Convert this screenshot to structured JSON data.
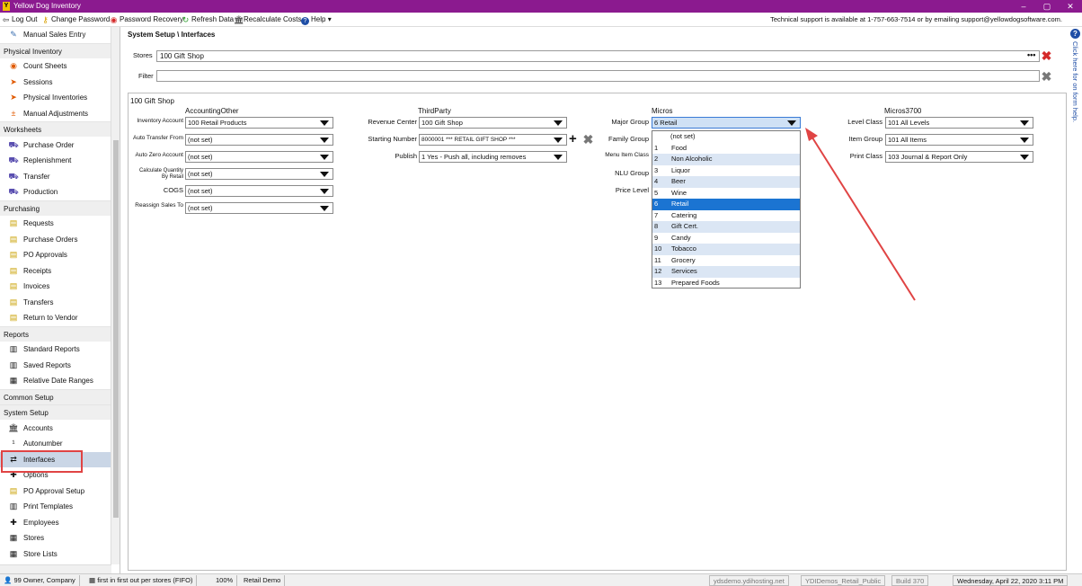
{
  "window": {
    "title": "Yellow Dog Inventory",
    "min": "–",
    "max": "▢",
    "close": "✕"
  },
  "toolbar": {
    "logout": "Log Out",
    "change_password": "Change Password",
    "password_recovery": "Password Recovery",
    "refresh": "Refresh Data",
    "recalculate": "Recalculate Costs",
    "help": "Help"
  },
  "support_text": "Technical support is available at 1-757-663-7514 or by emailing support@yellowdogsoftware.com.",
  "sidebar": {
    "items": [
      {
        "label": "Manual Sales Entry",
        "icon": "edit-icon",
        "kind": "item"
      },
      {
        "label": "Physical Inventory",
        "kind": "head"
      },
      {
        "label": "Count Sheets",
        "icon": "count-icon",
        "kind": "item"
      },
      {
        "label": "Sessions",
        "icon": "sessions-icon",
        "kind": "item"
      },
      {
        "label": "Physical Inventories",
        "icon": "physical-icon",
        "kind": "item"
      },
      {
        "label": "Manual Adjustments",
        "icon": "adjust-icon",
        "kind": "item"
      },
      {
        "label": "Worksheets",
        "kind": "head"
      },
      {
        "label": "Purchase Order",
        "icon": "truck-icon",
        "kind": "item"
      },
      {
        "label": "Replenishment",
        "icon": "truck-icon",
        "kind": "item"
      },
      {
        "label": "Transfer",
        "icon": "truck-icon",
        "kind": "item"
      },
      {
        "label": "Production",
        "icon": "truck-icon",
        "kind": "item"
      },
      {
        "label": "Purchasing",
        "kind": "head"
      },
      {
        "label": "Requests",
        "icon": "doc-icon",
        "kind": "item"
      },
      {
        "label": "Purchase Orders",
        "icon": "doc-icon",
        "kind": "item"
      },
      {
        "label": "PO Approvals",
        "icon": "doc-icon",
        "kind": "item"
      },
      {
        "label": "Receipts",
        "icon": "doc-icon",
        "kind": "item"
      },
      {
        "label": "Invoices",
        "icon": "doc-icon",
        "kind": "item"
      },
      {
        "label": "Transfers",
        "icon": "doc-icon",
        "kind": "item"
      },
      {
        "label": "Return to Vendor",
        "icon": "doc-icon",
        "kind": "item"
      },
      {
        "label": "Reports",
        "kind": "head"
      },
      {
        "label": "Standard Reports",
        "icon": "page-icon",
        "kind": "item"
      },
      {
        "label": "Saved Reports",
        "icon": "page-icon",
        "kind": "item"
      },
      {
        "label": "Relative Date Ranges",
        "icon": "calendar-icon",
        "kind": "item"
      },
      {
        "label": "Common Setup",
        "kind": "head"
      },
      {
        "label": "System Setup",
        "kind": "head"
      },
      {
        "label": "Accounts",
        "icon": "bank-icon",
        "kind": "item"
      },
      {
        "label": "Autonumber",
        "icon": "autonumber-icon",
        "kind": "item"
      },
      {
        "label": "Interfaces",
        "icon": "arrows-icon",
        "kind": "item",
        "selected": true
      },
      {
        "label": "Options",
        "icon": "plus-icon",
        "kind": "item"
      },
      {
        "label": "PO Approval Setup",
        "icon": "doc-icon",
        "kind": "item"
      },
      {
        "label": "Print Templates",
        "icon": "page-icon",
        "kind": "item"
      },
      {
        "label": "Employees",
        "icon": "plus-icon",
        "kind": "item"
      },
      {
        "label": "Stores",
        "icon": "store-icon",
        "kind": "item"
      },
      {
        "label": "Store Lists",
        "icon": "store-icon",
        "kind": "item"
      }
    ]
  },
  "main": {
    "breadcrumb": "System Setup \\ Interfaces",
    "stores_label": "Stores",
    "stores_value": "100 Gift Shop",
    "filter_label": "Filter",
    "filter_value": "",
    "group_title": "100 Gift Shop",
    "col_accounting": "AccountingOther",
    "col_thirdparty": "ThirdParty",
    "col_micros": "Micros",
    "col_micros3700": "Micros3700",
    "accounting": {
      "inventory_account_label": "Inventory Account",
      "inventory_account_value": "100 Retail Products",
      "auto_transfer_label": "Auto Transfer From",
      "auto_transfer_value": "(not set)",
      "auto_zero_label": "Auto Zero Account",
      "auto_zero_value": "(not set)",
      "calc_qty_label_1": "Calculate Quantity",
      "calc_qty_label_2": "By Retail",
      "calc_qty_value": "(not set)",
      "cogs_label": "COGS",
      "cogs_value": "(not set)",
      "reassign_label": "Reassign Sales To",
      "reassign_value": "(not set)"
    },
    "thirdparty": {
      "revenue_center_label": "Revenue Center",
      "revenue_center_value": "100 Gift Shop",
      "starting_number_label": "Starting Number",
      "starting_number_value": "8000001 *** RETAIL GIFT SHOP ***",
      "publish_label": "Publish",
      "publish_value": "1 Yes - Push all, including removes"
    },
    "micros": {
      "major_group_label": "Major Group",
      "major_group_value": "6 Retail",
      "family_group_label": "Family Group",
      "menu_item_class_label": "Menu Item Class",
      "nlu_group_label": "NLU Group",
      "price_level_label": "Price Level"
    },
    "micros3700": {
      "level_class_label": "Level Class",
      "level_class_value": "101 All Levels",
      "item_group_label": "Item Group",
      "item_group_value": "101 All Items",
      "print_class_label": "Print Class",
      "print_class_value": "103 Journal & Report Only"
    }
  },
  "dropdown_options": [
    {
      "num": "",
      "label": "(not set)"
    },
    {
      "num": "1",
      "label": "Food"
    },
    {
      "num": "2",
      "label": "Non Alcoholic"
    },
    {
      "num": "3",
      "label": "Liquor"
    },
    {
      "num": "4",
      "label": "Beer"
    },
    {
      "num": "5",
      "label": "Wine"
    },
    {
      "num": "6",
      "label": "Retail",
      "selected": true
    },
    {
      "num": "7",
      "label": "Catering"
    },
    {
      "num": "8",
      "label": "Gift Cert."
    },
    {
      "num": "9",
      "label": "Candy"
    },
    {
      "num": "10",
      "label": "Tobacco"
    },
    {
      "num": "11",
      "label": "Grocery"
    },
    {
      "num": "12",
      "label": "Services"
    },
    {
      "num": "13",
      "label": "Prepared Foods"
    }
  ],
  "help_text": "Click here for on form help.",
  "status": {
    "user": "99 Owner, Company",
    "costing": "first in first out per stores (FIFO)",
    "zoom": "100%",
    "database": "Retail Demo",
    "host": "ydsdemo.ydihosting.net",
    "instance": "YDIDemos_Retail_Public",
    "build": "Build 370",
    "datetime": "Wednesday, April 22, 2020 3:11 PM"
  },
  "colors": {
    "titlebar": "#8b1a8f",
    "accent": "#1b74d2",
    "annotation": "#e04444"
  }
}
